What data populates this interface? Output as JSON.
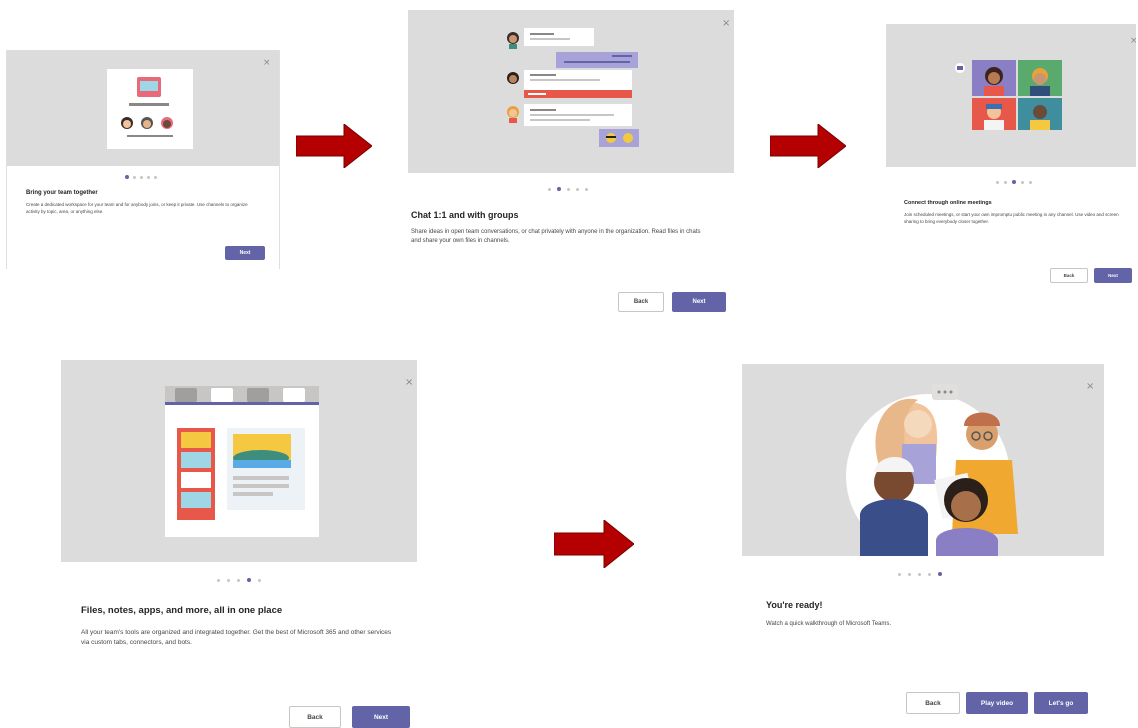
{
  "colors": {
    "accent": "#6264a7",
    "hero_bg": "#dcdcdc",
    "arrow": "#b40000",
    "close": "#8a8886"
  },
  "icons": {
    "close": "×"
  },
  "slides": [
    {
      "title": "Bring your team together",
      "description": "Create a dedicated workspace for your team and for anybody joins, or keep it private. Use channels to organize activity by topic, area, or anything else.",
      "next_label": "Next",
      "active_step": 1
    },
    {
      "title": "Chat 1:1 and with groups",
      "description": "Share ideas in open team conversations, or chat privately with anyone in the organization. Read files in chats and share your own files in channels.",
      "back_label": "Back",
      "next_label": "Next",
      "active_step": 2
    },
    {
      "title": "Connect through online meetings",
      "description": "Join scheduled meetings, or start your own impromptu public meeting in any channel. Use video and screen sharing to bring everybody closer together.",
      "back_label": "Back",
      "next_label": "Next",
      "active_step": 3
    },
    {
      "title": "Files, notes, apps, and more, all in one place",
      "description": "All your team's tools are organized and integrated together. Get the best of Microsoft 365 and other services via custom tabs, connectors, and bots.",
      "back_label": "Back",
      "next_label": "Next",
      "active_step": 4
    },
    {
      "title": "You're ready!",
      "description": "Watch a quick walkthrough of Microsoft Teams.",
      "back_label": "Back",
      "play_label": "Play video",
      "go_label": "Let's go",
      "active_step": 5
    }
  ]
}
